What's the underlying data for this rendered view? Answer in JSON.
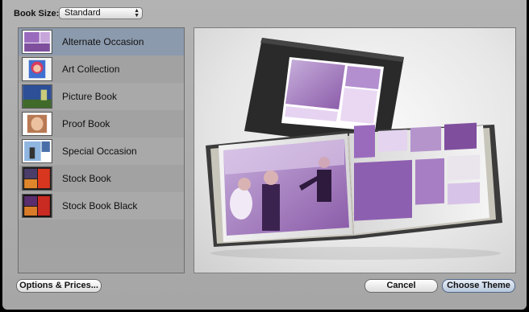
{
  "header": {
    "book_size_label": "Book Size:",
    "book_size_value": "Standard"
  },
  "themes": [
    {
      "label": "Alternate Occasion",
      "selected": true
    },
    {
      "label": "Art Collection",
      "selected": false
    },
    {
      "label": "Picture Book",
      "selected": false
    },
    {
      "label": "Proof Book",
      "selected": false
    },
    {
      "label": "Special Occasion",
      "selected": false
    },
    {
      "label": "Stock Book",
      "selected": false
    },
    {
      "label": "Stock Book Black",
      "selected": false
    }
  ],
  "buttons": {
    "options": "Options & Prices...",
    "cancel": "Cancel",
    "choose": "Choose Theme"
  },
  "colors": {
    "selection": "#8c9aad",
    "panel": "#a6a6a6",
    "photo_tint": "#8a5aa8"
  },
  "icons": {
    "select_arrows": "up-down-chevron-icon"
  }
}
